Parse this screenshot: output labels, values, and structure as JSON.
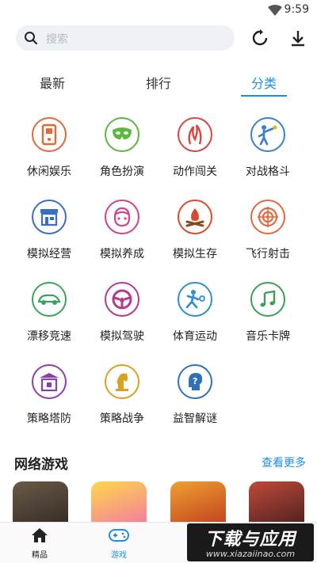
{
  "status_bar": {
    "time": "9:59",
    "wifi_icon": "wifi-icon"
  },
  "search": {
    "placeholder": "搜索",
    "icon": "search-icon"
  },
  "header_actions": {
    "refresh_icon": "refresh-icon",
    "download_icon": "download-icon"
  },
  "tabs": [
    {
      "label": "最新",
      "active": false
    },
    {
      "label": "排行",
      "active": false
    },
    {
      "label": "分类",
      "active": true
    }
  ],
  "categories": [
    {
      "label": "休闲娱乐",
      "icon": "handheld-console-icon",
      "color": "#e2693a"
    },
    {
      "label": "角色扮演",
      "icon": "mask-icon",
      "color": "#5cb83b"
    },
    {
      "label": "动作闯关",
      "icon": "action-figure-icon",
      "color": "#d9463f"
    },
    {
      "label": "对战格斗",
      "icon": "fighter-icon",
      "color": "#3a7fcf"
    },
    {
      "label": "模拟经营",
      "icon": "shop-icon",
      "color": "#3a6fbf"
    },
    {
      "label": "模拟养成",
      "icon": "character-icon",
      "color": "#d1428e"
    },
    {
      "label": "模拟生存",
      "icon": "campfire-icon",
      "color": "#d94a2c"
    },
    {
      "label": "飞行射击",
      "icon": "target-icon",
      "color": "#e06a3f"
    },
    {
      "label": "漂移竞速",
      "icon": "race-car-icon",
      "color": "#3ba35e"
    },
    {
      "label": "模拟驾驶",
      "icon": "steering-wheel-icon",
      "color": "#b53a8c"
    },
    {
      "label": "体育运动",
      "icon": "tennis-player-icon",
      "color": "#2f8fd0"
    },
    {
      "label": "音乐卡牌",
      "icon": "music-note-icon",
      "color": "#3f9d5a"
    },
    {
      "label": "策略塔防",
      "icon": "tower-icon",
      "color": "#8a3fa9"
    },
    {
      "label": "策略战争",
      "icon": "chess-knight-icon",
      "color": "#d8a21f"
    },
    {
      "label": "益智解谜",
      "icon": "question-head-icon",
      "color": "#2f72b8"
    }
  ],
  "section": {
    "title": "网络游戏",
    "more": "查看更多"
  },
  "games": [
    {
      "icon": "game-thumb-1",
      "color": "#4a4036"
    },
    {
      "icon": "game-thumb-2",
      "color": "#f2b6d4"
    },
    {
      "icon": "game-thumb-3",
      "color": "#c9442a"
    },
    {
      "icon": "game-thumb-4",
      "color": "#7a2c2c"
    }
  ],
  "bottom_nav": [
    {
      "label": "精品",
      "icon": "home-icon",
      "active": false
    },
    {
      "label": "游戏",
      "icon": "gamepad-icon",
      "active": true
    }
  ],
  "watermark": {
    "title": "下载与应用",
    "url": "www.xiazaiinao.com"
  }
}
